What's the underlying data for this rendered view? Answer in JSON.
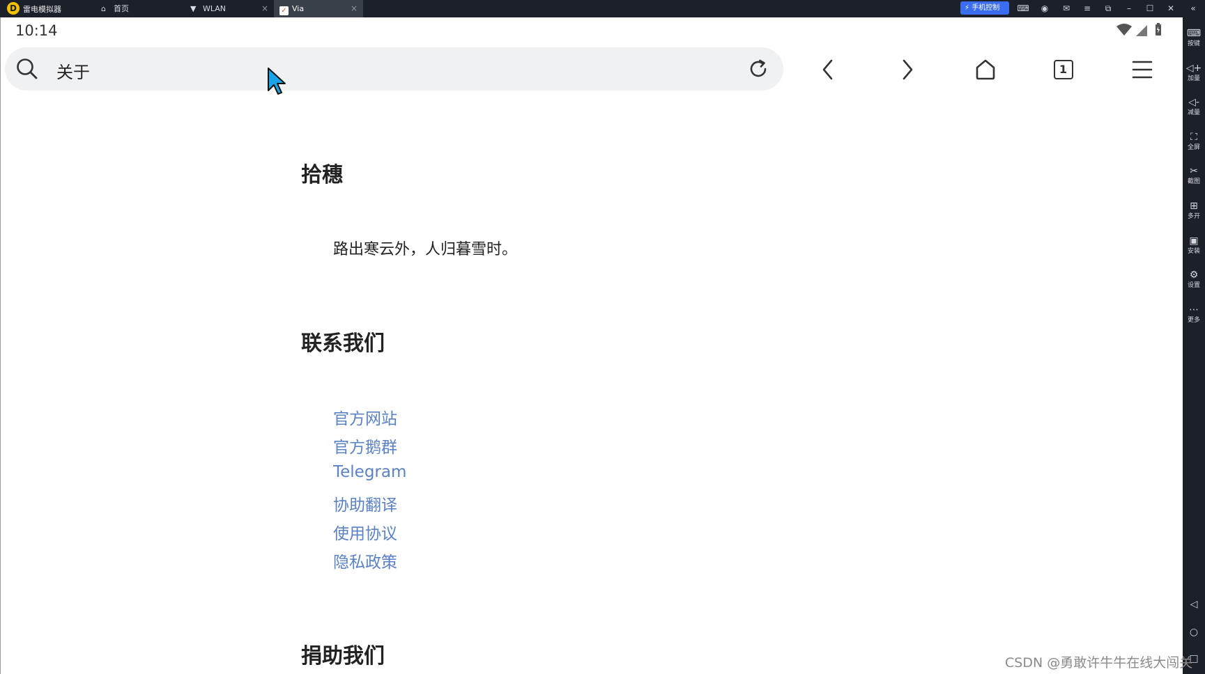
{
  "emulator": {
    "app_name": "雷电模拟器",
    "tabs": [
      {
        "label": "首页",
        "icon": "home-icon"
      },
      {
        "label": "WLAN",
        "icon": "wifi-icon"
      },
      {
        "label": "Via",
        "icon": "via-icon",
        "active": true
      }
    ],
    "phone_control_label": "手机控制",
    "sidebar": [
      {
        "label": "按键",
        "icon": "keyboard-icon"
      },
      {
        "label": "加量",
        "icon": "volume-up-icon"
      },
      {
        "label": "减量",
        "icon": "volume-down-icon"
      },
      {
        "label": "全屏",
        "icon": "fullscreen-icon"
      },
      {
        "label": "截图",
        "icon": "scissors-icon"
      },
      {
        "label": "多开",
        "icon": "multi-instance-icon"
      },
      {
        "label": "安装",
        "icon": "apk-install-icon"
      },
      {
        "label": "设置",
        "icon": "gear-icon"
      },
      {
        "label": "更多",
        "icon": "more-icon"
      }
    ]
  },
  "status_bar": {
    "time": "10:14"
  },
  "browser": {
    "address_text": "关于",
    "tab_count": "1"
  },
  "page": {
    "sections": [
      {
        "title": "拾穗"
      },
      {
        "title": "联系我们"
      },
      {
        "title": "捐助我们"
      }
    ],
    "poem": "路出寒云外，人归暮雪时。",
    "links": [
      "官方网站",
      "官方鹅群",
      "Telegram",
      "协助翻译",
      "使用协议",
      "隐私政策"
    ]
  },
  "watermark": "CSDN @勇敢许牛牛在线大闯关",
  "colors": {
    "emulator_chrome": "#1c2129",
    "link": "#5b82c4",
    "address_bar_bg": "#f0f1f3",
    "phone_control_bg": "#3a6df0"
  }
}
